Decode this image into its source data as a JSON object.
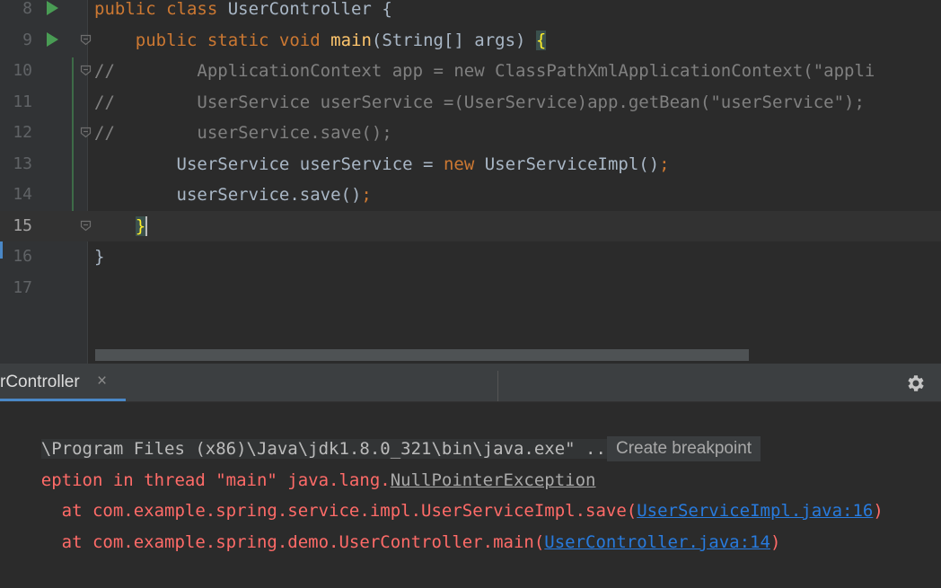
{
  "editor": {
    "lines": [
      {
        "num": "8",
        "tokens": [
          [
            "kw",
            "public "
          ],
          [
            "kw",
            "class "
          ],
          [
            "plain",
            "UserController "
          ],
          [
            "plain",
            "{"
          ]
        ]
      },
      {
        "num": "9",
        "tokens": [
          [
            "plain",
            "    "
          ],
          [
            "kw",
            "public "
          ],
          [
            "kw",
            "static "
          ],
          [
            "kw",
            "void "
          ],
          [
            "fn",
            "main"
          ],
          [
            "plain",
            "(String[] args) "
          ],
          [
            "brace",
            "{"
          ]
        ]
      },
      {
        "num": "10",
        "tokens": [
          [
            "cm",
            "//        ApplicationContext app = new ClassPathXmlApplicationContext(\"appli"
          ]
        ]
      },
      {
        "num": "11",
        "tokens": [
          [
            "cm",
            "//        UserService userService =(UserService)app.getBean(\"userService\");"
          ]
        ]
      },
      {
        "num": "12",
        "tokens": [
          [
            "cm",
            "//        userService.save();"
          ]
        ]
      },
      {
        "num": "13",
        "tokens": [
          [
            "plain",
            "        UserService userService = "
          ],
          [
            "kw",
            "new "
          ],
          [
            "plain",
            "UserServiceImpl()"
          ],
          [
            "kw",
            ";"
          ]
        ]
      },
      {
        "num": "14",
        "tokens": [
          [
            "plain",
            "        userService.save()"
          ],
          [
            "kw",
            ";"
          ]
        ]
      },
      {
        "num": "15",
        "tokens": [
          [
            "plain",
            "    "
          ],
          [
            "brace",
            "}"
          ]
        ]
      },
      {
        "num": "16",
        "tokens": [
          [
            "plain",
            "}"
          ]
        ]
      },
      {
        "num": "17",
        "tokens": []
      }
    ],
    "current_line": "15"
  },
  "run_window": {
    "tab_label": "rController",
    "tab_close": "×",
    "cmd_line": "\\Program Files (x86)\\Java\\jdk1.8.0_321\\bin\\java.exe\" ...",
    "exception_prefix": "eption in thread \"main\" java.lang.",
    "exception_class": "NullPointerException",
    "tooltip": "Create breakpoint",
    "trace": [
      {
        "prefix": "  at com.example.spring.service.impl.UserServiceImpl.save(",
        "link": "UserServiceImpl.java:16",
        "suffix": ")"
      },
      {
        "prefix": "  at com.example.spring.demo.UserController.main(",
        "link": "UserController.java:14",
        "suffix": ")"
      }
    ]
  },
  "icons": {
    "run": "run-gutter-icon",
    "fold": "fold-icon",
    "settings": "gear-icon",
    "close": "close-icon"
  },
  "colors": {
    "background": "#2b2b2b",
    "keyword": "#cc7832",
    "function": "#ffc66d",
    "comment": "#808080",
    "error": "#ff6b68",
    "link": "#287bde",
    "run": "#499c54"
  }
}
